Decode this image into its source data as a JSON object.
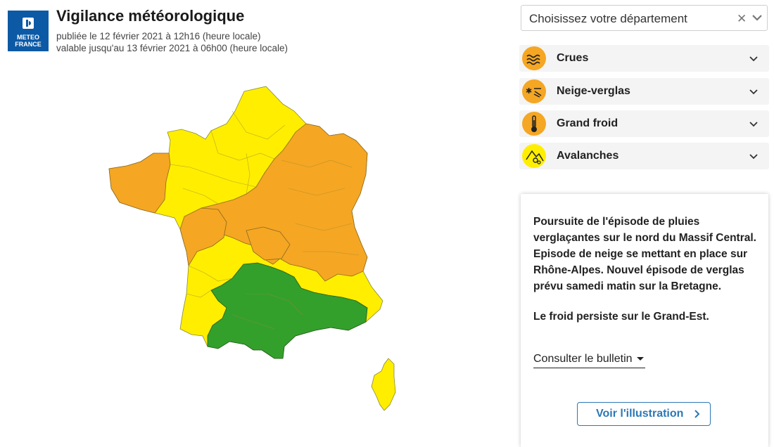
{
  "header": {
    "logo_line1": "METEO",
    "logo_line2": "FRANCE",
    "title": "Vigilance météorologique",
    "published": "publiée le 12 février 2021 à 12h16 (heure locale)",
    "valid_until": "valable jusqu'au 13 février 2021 à 06h00 (heure locale)"
  },
  "department_select": {
    "placeholder": "Choisissez votre département",
    "clear_icon": "close-icon",
    "toggle_icon": "chevron-down-icon"
  },
  "risks": [
    {
      "label": "Crues",
      "icon": "flood-icon",
      "color": "#f5a623"
    },
    {
      "label": "Neige-verglas",
      "icon": "snow-ice-icon",
      "color": "#f5a623"
    },
    {
      "label": "Grand froid",
      "icon": "thermometer-icon",
      "color": "#f5a623"
    },
    {
      "label": "Avalanches",
      "icon": "avalanche-icon",
      "color": "#ffee00"
    }
  ],
  "map": {
    "legend_colors": {
      "vert": "#33a02c",
      "jaune": "#ffee00",
      "orange": "#f5a623"
    }
  },
  "comment": {
    "text": "Poursuite de l'épisode de pluies verglaçantes sur le nord du Massif Central. Episode de neige se mettant en place sur Rhône-Alpes. Nouvel épisode de verglas prévu samedi matin sur la Bretagne.",
    "text2": "Le froid persiste sur le Grand-Est.",
    "bulletin_link": "Consulter le bulletin",
    "illustration_button": "Voir l'illustration"
  }
}
